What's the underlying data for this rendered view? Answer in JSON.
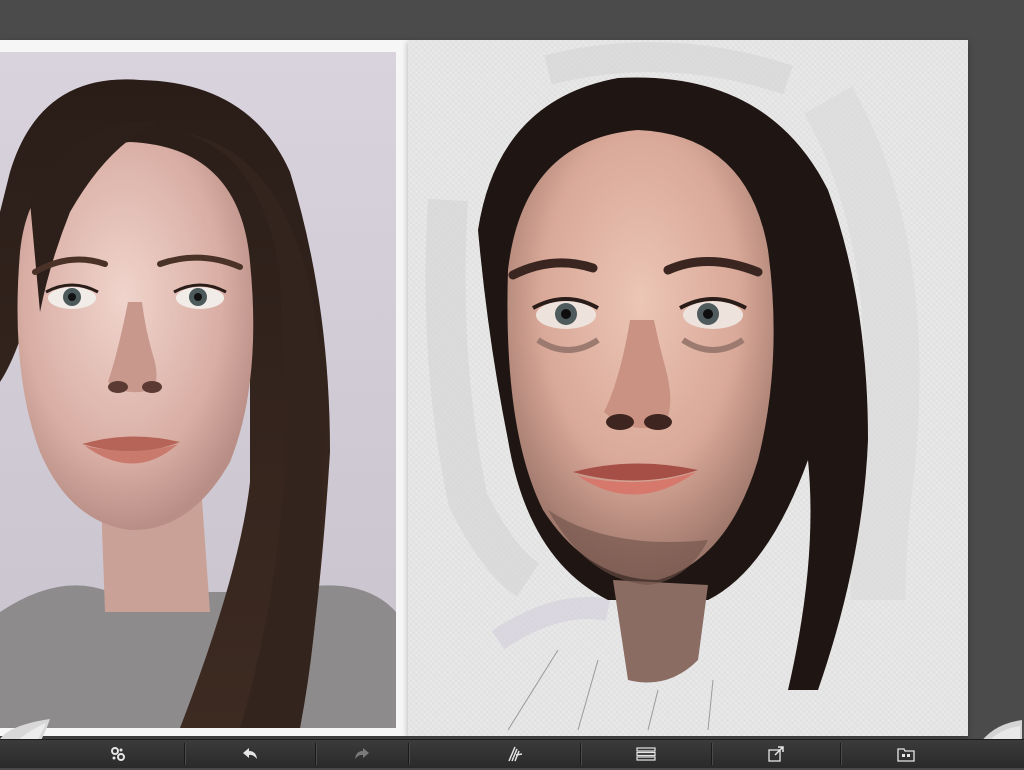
{
  "app": {
    "mode": "painting-with-reference"
  },
  "reference_panel": {
    "image": "reference-photo-portrait"
  },
  "canvas": {
    "image": "oil-painting-portrait-in-progress"
  },
  "toolbar": {
    "buttons": [
      {
        "name": "settings-gear-icon",
        "enabled": true
      },
      {
        "name": "undo-arrow-icon",
        "enabled": true
      },
      {
        "name": "redo-arrow-icon",
        "enabled": false
      },
      {
        "name": "brush-tool-icon",
        "enabled": true
      },
      {
        "name": "layers-icon",
        "enabled": true
      },
      {
        "name": "share-export-icon",
        "enabled": true
      },
      {
        "name": "gallery-folder-icon",
        "enabled": true
      }
    ]
  },
  "colors": {
    "background": "#4b4b4b",
    "toolbar": "#2e2e2e",
    "canvas": "#e9e9e9",
    "hair": "#1e1411",
    "skin": "#e2b7a6",
    "lips": "#c96a60"
  }
}
